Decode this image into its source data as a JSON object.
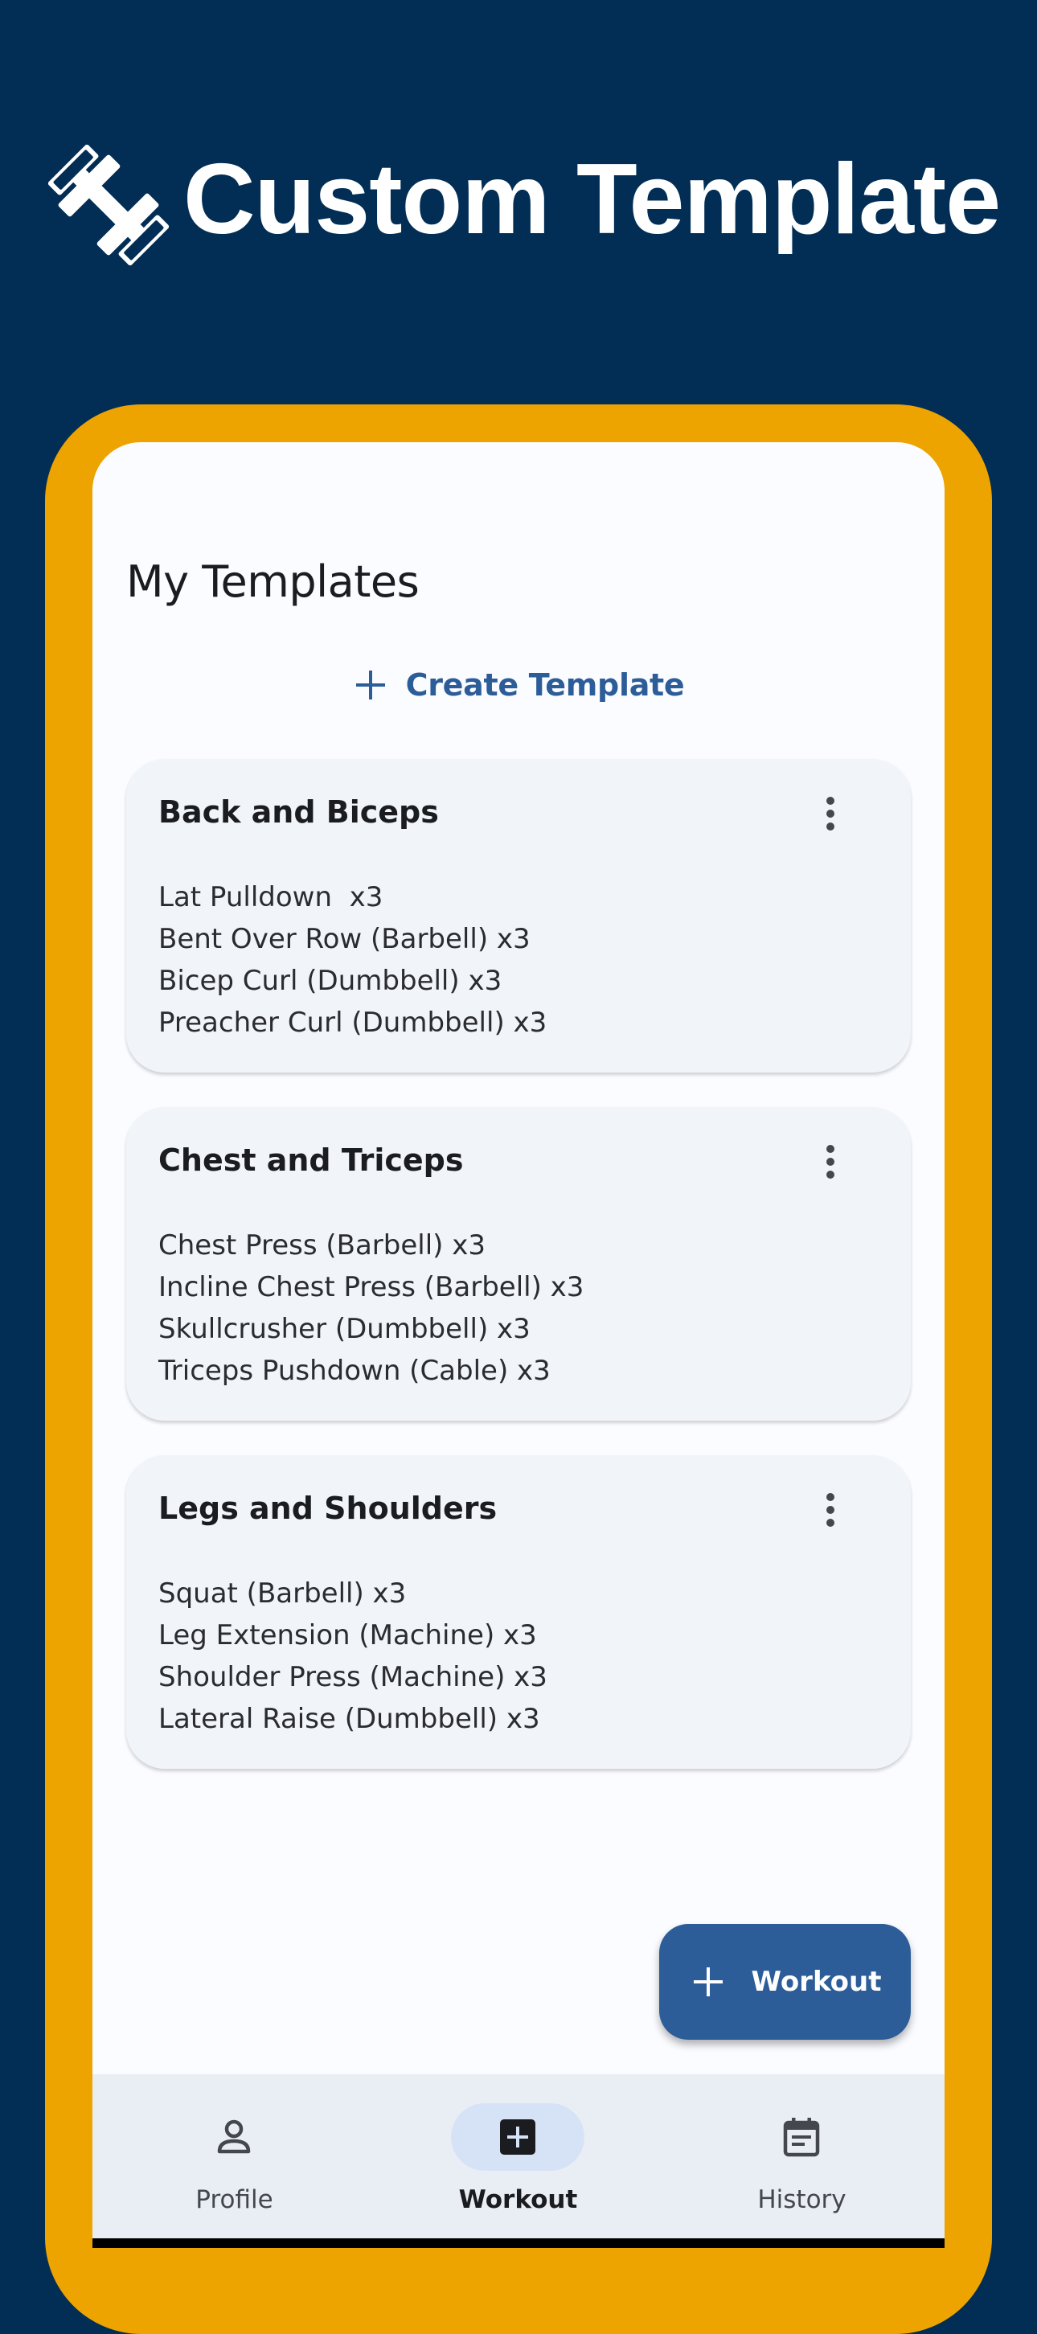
{
  "banner": {
    "title": "Custom Template",
    "icon": "dumbbell-icon"
  },
  "colors": {
    "background": "#022e55",
    "frame": "#eea400",
    "accent": "#2d5d98",
    "card": "#f1f4f8",
    "nav": "#e9eef5"
  },
  "screen": {
    "title": "My Templates",
    "create_label": "Create Template"
  },
  "templates": [
    {
      "name": "Back and Biceps",
      "exercises": [
        "Lat Pulldown  x3",
        "Bent Over Row (Barbell) x3",
        "Bicep Curl (Dumbbell) x3",
        "Preacher Curl (Dumbbell) x3"
      ]
    },
    {
      "name": "Chest and Triceps",
      "exercises": [
        "Chest Press (Barbell) x3",
        "Incline Chest Press (Barbell) x3",
        "Skullcrusher (Dumbbell) x3",
        "Triceps Pushdown (Cable) x3"
      ]
    },
    {
      "name": "Legs and Shoulders",
      "exercises": [
        "Squat (Barbell) x3",
        "Leg Extension (Machine) x3",
        "Shoulder Press (Machine) x3",
        "Lateral Raise (Dumbbell) x3"
      ]
    }
  ],
  "fab": {
    "label": "Workout"
  },
  "nav": {
    "items": [
      {
        "label": "Profile",
        "icon": "person-icon",
        "active": false
      },
      {
        "label": "Workout",
        "icon": "add-box-icon",
        "active": true
      },
      {
        "label": "History",
        "icon": "calendar-icon",
        "active": false
      }
    ]
  }
}
